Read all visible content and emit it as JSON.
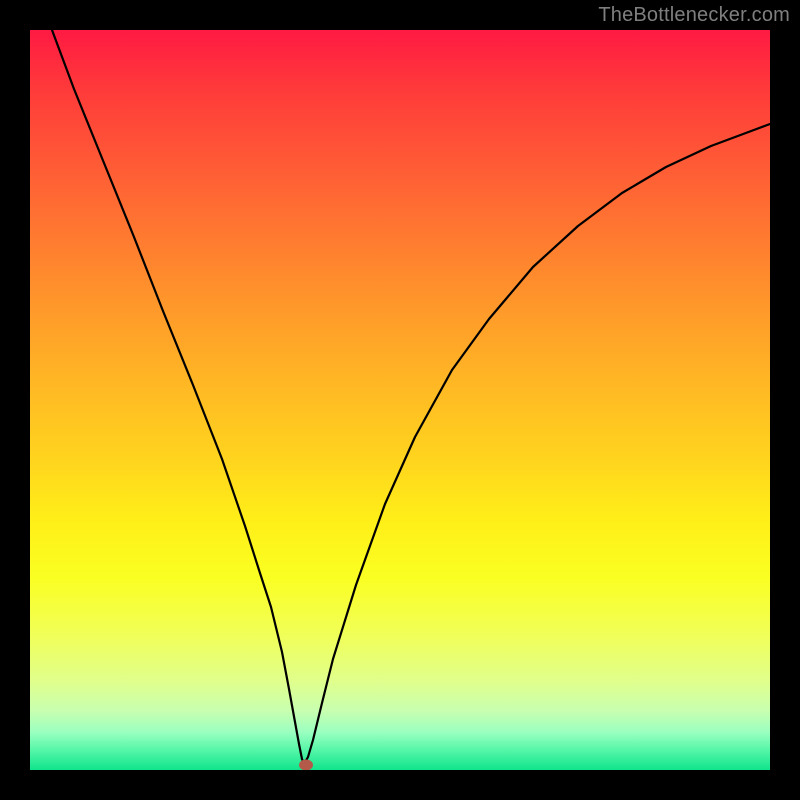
{
  "watermark": {
    "text": "TheBottlenecker.com"
  },
  "chart_data": {
    "type": "line",
    "title": "",
    "xlabel": "",
    "ylabel": "",
    "xlim": [
      0,
      100
    ],
    "ylim": [
      0,
      100
    ],
    "series": [
      {
        "name": "bottleneck-curve",
        "x": [
          3,
          6,
          10,
          14,
          18,
          22,
          26,
          29,
          31,
          32.5,
          34,
          35,
          35.8,
          36.3,
          36.7,
          37,
          37.5,
          38.2,
          39.5,
          41,
          44,
          48,
          52,
          57,
          62,
          68,
          74,
          80,
          86,
          92,
          100
        ],
        "y": [
          100,
          92,
          82,
          72,
          62,
          52,
          42,
          33,
          27,
          22,
          16,
          11,
          6.5,
          3.5,
          1.5,
          0.8,
          1.8,
          4,
          9,
          15,
          25,
          36,
          45,
          54,
          61,
          68,
          73.5,
          78,
          81.5,
          84.3,
          87.3
        ]
      }
    ],
    "marker": {
      "x": 37.3,
      "y": 0.7,
      "color": "#b35a4a"
    },
    "gradient_bands": [
      {
        "pos": 0.0,
        "color": "#ff1a43"
      },
      {
        "pos": 0.5,
        "color": "#ffd41e"
      },
      {
        "pos": 0.97,
        "color": "#50f5a6"
      },
      {
        "pos": 1.0,
        "color": "#10e48c"
      }
    ]
  }
}
